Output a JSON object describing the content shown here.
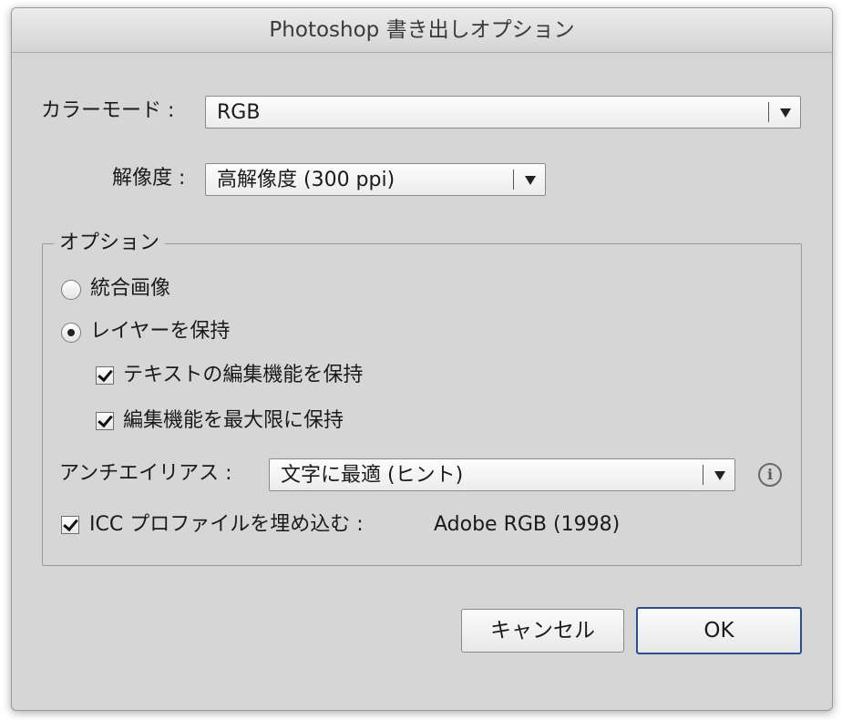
{
  "window": {
    "title": "Photoshop 書き出しオプション"
  },
  "color_mode": {
    "label": "カラーモード :",
    "value": "RGB"
  },
  "resolution": {
    "label": "解像度 :",
    "value": "高解像度 (300 ppi)"
  },
  "options": {
    "group_title": "オプション",
    "flatten_label": "統合画像",
    "flatten_selected": false,
    "keep_layers_label": "レイヤーを保持",
    "keep_layers_selected": true,
    "keep_text_editable_label": "テキストの編集機能を保持",
    "keep_text_editable_checked": true,
    "max_editability_label": "編集機能を最大限に保持",
    "max_editability_checked": true,
    "antialias_label": "アンチエイリアス :",
    "antialias_value": "文字に最適 (ヒント)",
    "icc_label": "ICC プロファイルを埋め込む :",
    "icc_checked": true,
    "icc_value": "Adobe RGB (1998)"
  },
  "buttons": {
    "cancel": "キャンセル",
    "ok": "OK"
  }
}
